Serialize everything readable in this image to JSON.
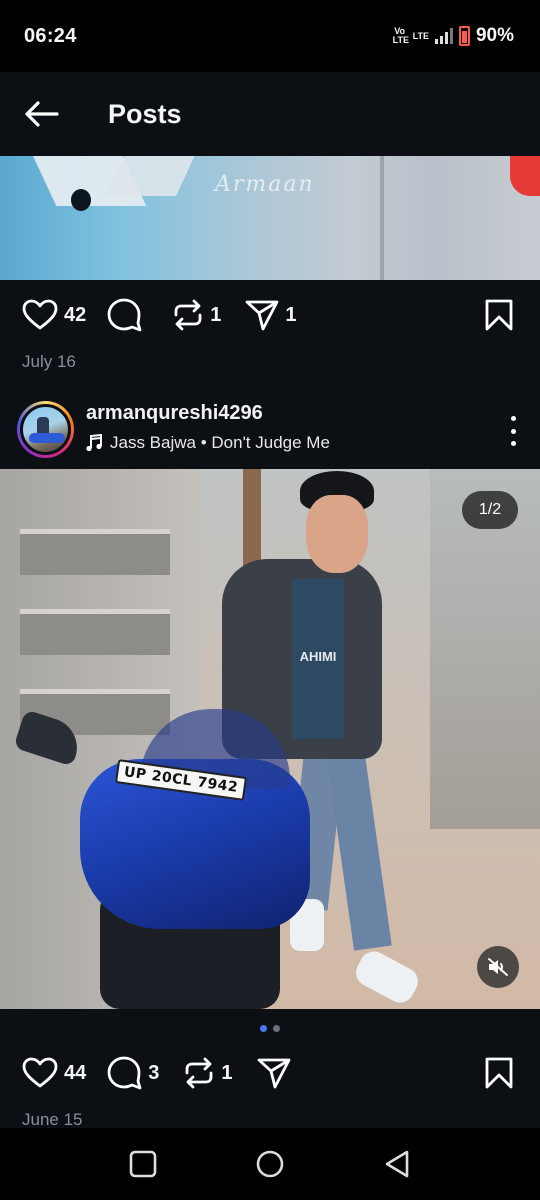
{
  "status_bar": {
    "time": "06:24",
    "volte_label": "Vo LTE",
    "lte_label": "LTE",
    "battery_percent": "90%",
    "battery_level": 0.9
  },
  "header": {
    "title": "Posts",
    "back_icon": "arrow-left-icon"
  },
  "post1": {
    "media_signature": "Armaan",
    "likes": "42",
    "comments": "",
    "reposts": "1",
    "shares": "1",
    "date": "July 16",
    "muted": true
  },
  "post2": {
    "username": "armanqureshi4296",
    "music": "Jass Bajwa • Don't Judge Me",
    "page_indicator": "1/2",
    "license_plate": "UP 20CL 7942",
    "shirt_text": "AHIMI",
    "likes": "44",
    "comments": "3",
    "reposts": "1",
    "shares": "",
    "date": "June 15",
    "carousel_total": 2,
    "carousel_active": 1,
    "muted": true
  },
  "colors": {
    "background": "#0c0f14",
    "status_bar": "#000000",
    "text_primary": "#f5f5f5",
    "text_secondary": "#8b8f98",
    "carousel_active": "#4a7cf0",
    "carousel_inactive": "#6b6f77",
    "battery": "#ff5a4e"
  },
  "navbar": {
    "items": [
      "recents-square-icon",
      "home-circle-icon",
      "back-triangle-icon"
    ]
  }
}
